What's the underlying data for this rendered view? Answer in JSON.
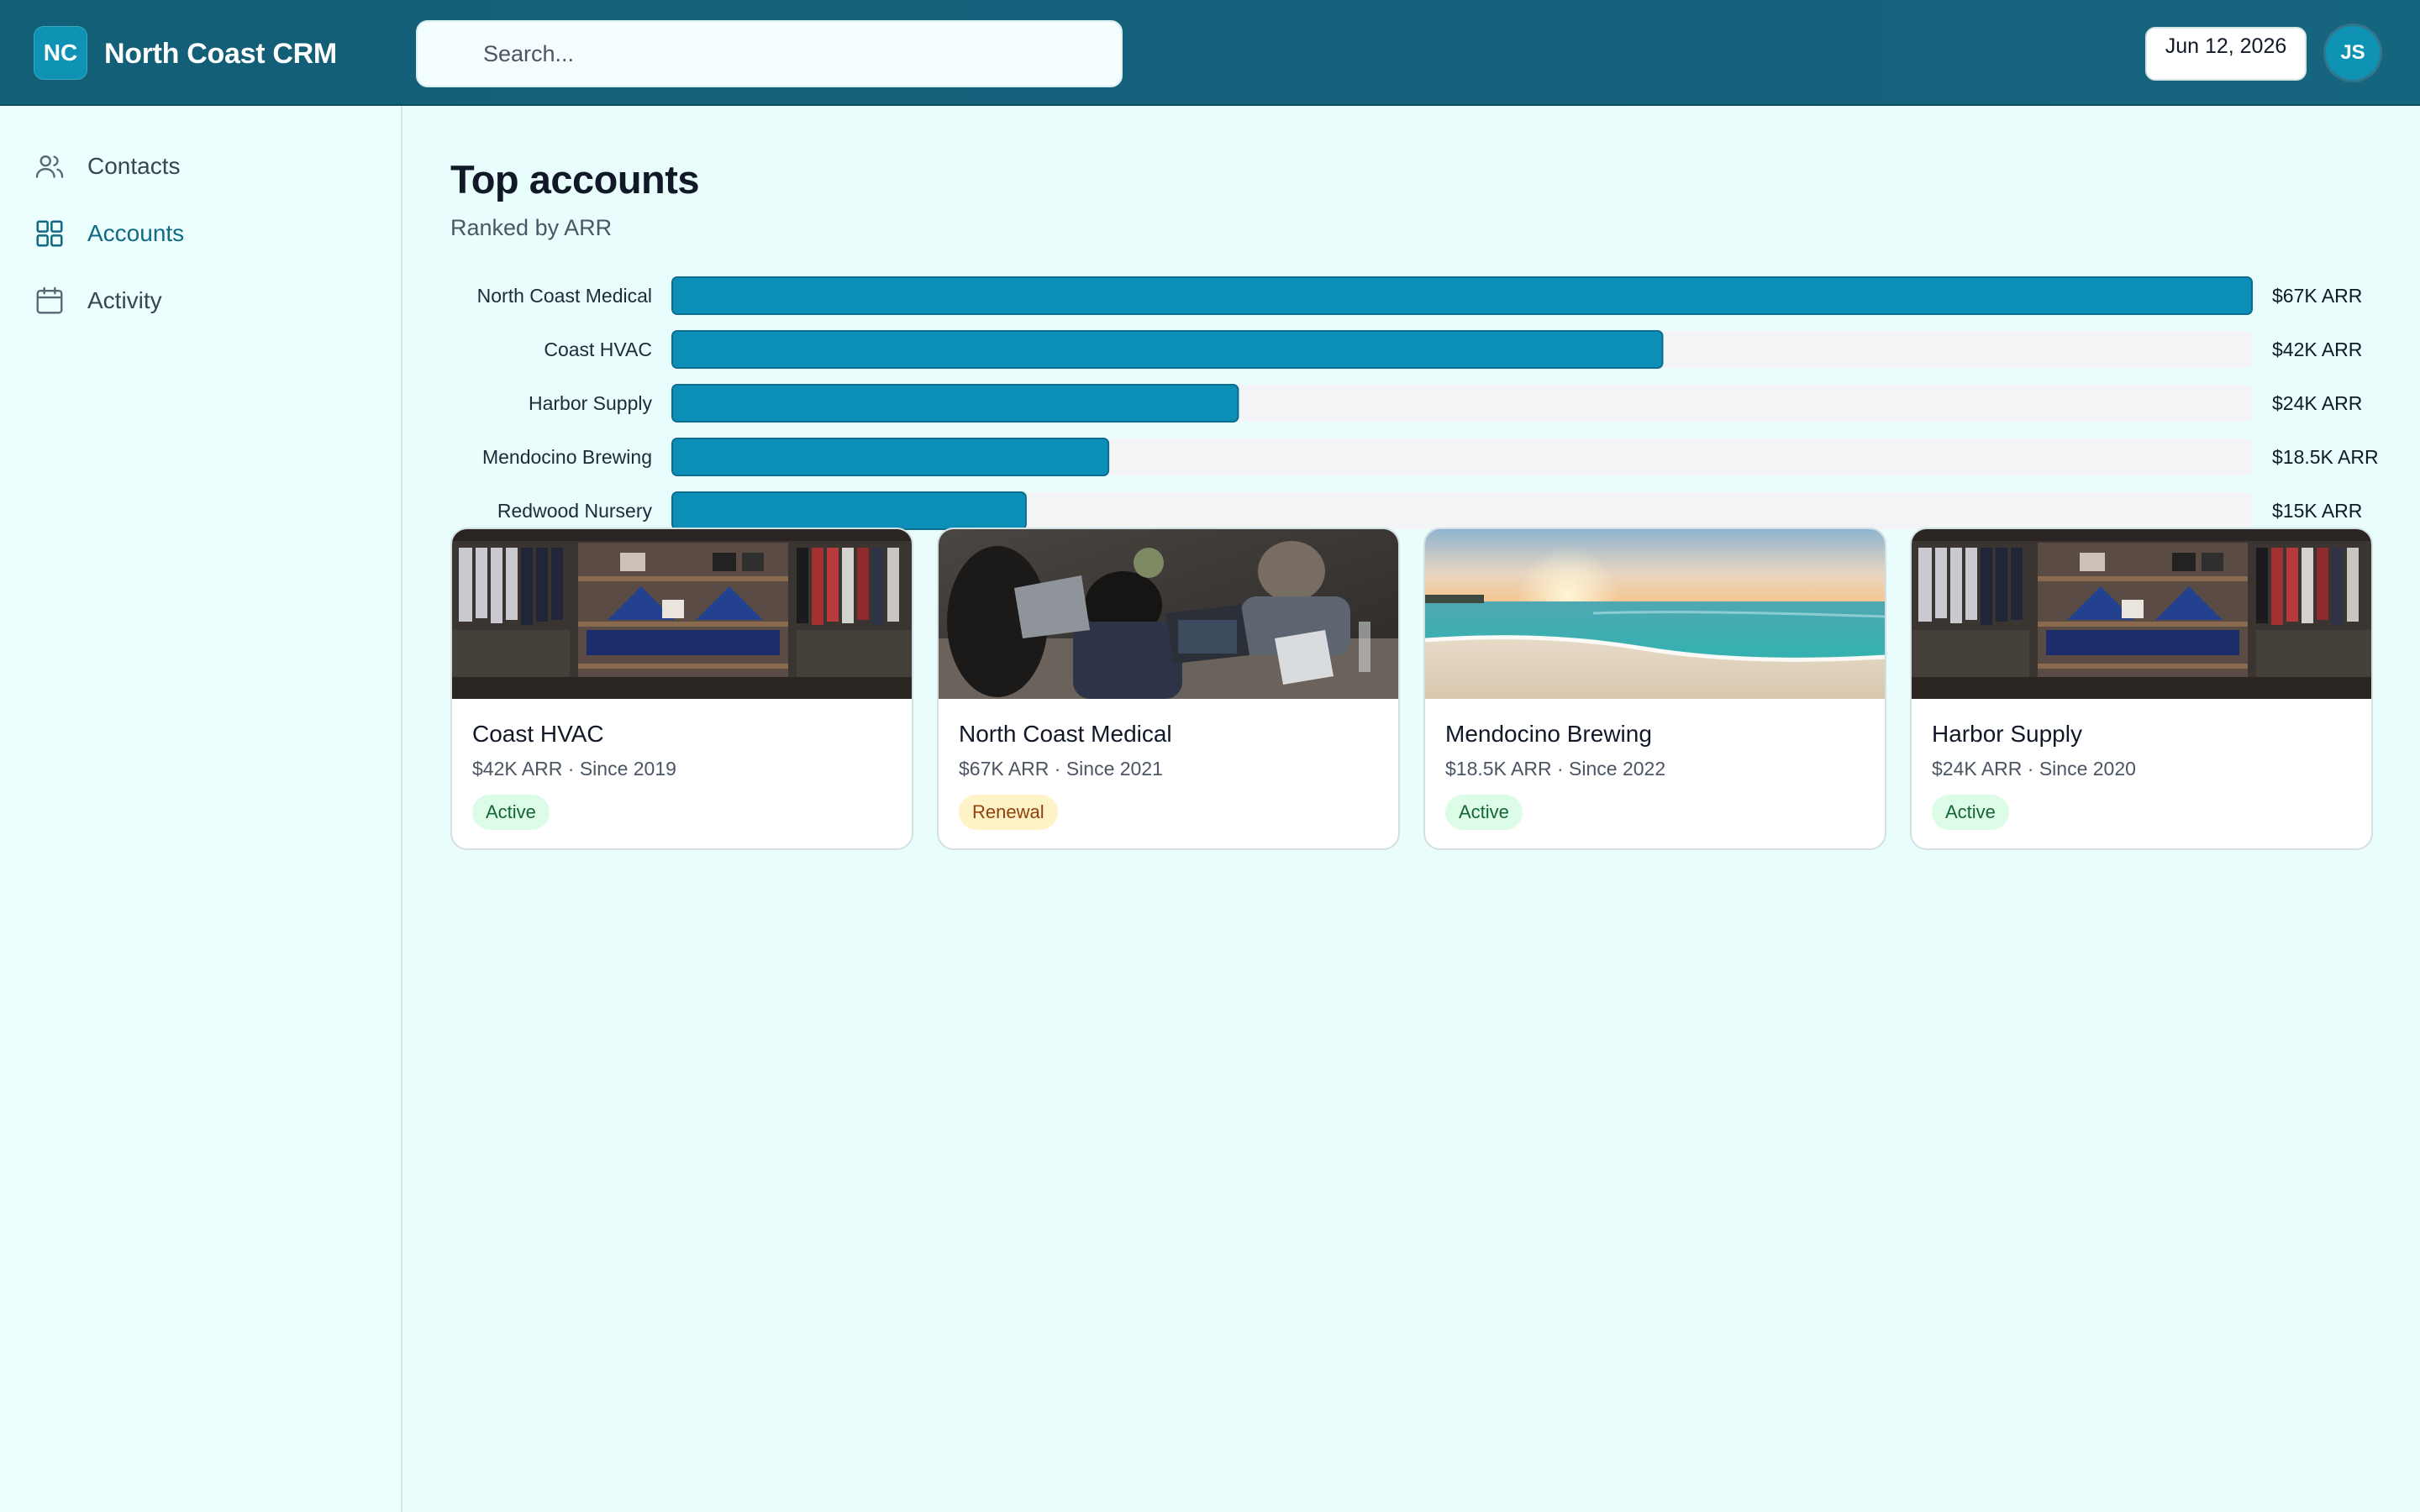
{
  "app": {
    "logo_initials": "NC",
    "name": "North Coast CRM"
  },
  "search": {
    "placeholder": "Search...",
    "value": ""
  },
  "header": {
    "date": "Jun 12, 2026",
    "user_initials": "JS"
  },
  "sidebar": {
    "items": [
      {
        "label": "Contacts",
        "icon": "users-icon",
        "active": false
      },
      {
        "label": "Accounts",
        "icon": "grid-icon",
        "active": true
      },
      {
        "label": "Activity",
        "icon": "calendar-icon",
        "active": false
      }
    ]
  },
  "main": {
    "title": "Top accounts",
    "subtitle": "Ranked by ARR"
  },
  "chart_data": {
    "type": "bar",
    "orientation": "horizontal",
    "categories": [
      "North Coast Medical",
      "Coast HVAC",
      "Harbor Supply",
      "Mendocino Brewing",
      "Redwood Nursery"
    ],
    "values": [
      67,
      42,
      24,
      18.5,
      15
    ],
    "value_labels": [
      "$67K ARR",
      "$42K ARR",
      "$24K ARR",
      "$18.5K ARR",
      "$15K ARR"
    ],
    "unit": "K ARR",
    "xlim": [
      0,
      67
    ],
    "grid": false,
    "legend": "none",
    "bar_color": "#0b8fb6",
    "track_color": "#f3f4f5"
  },
  "cards": [
    {
      "title": "Coast HVAC",
      "meta": "$42K ARR · Since 2019",
      "status": "Active",
      "status_kind": "active",
      "image": "retail-shop-photo"
    },
    {
      "title": "North Coast Medical",
      "meta": "$67K ARR · Since 2021",
      "status": "Renewal",
      "status_kind": "renewal",
      "image": "team-laptops-photo"
    },
    {
      "title": "Mendocino Brewing",
      "meta": "$18.5K ARR · Since 2022",
      "status": "Active",
      "status_kind": "active",
      "image": "beach-sunset-photo"
    },
    {
      "title": "Harbor Supply",
      "meta": "$24K ARR · Since 2020",
      "status": "Active",
      "status_kind": "active",
      "image": "retail-shop-photo"
    }
  ],
  "colors": {
    "header_bg": "#15607a",
    "accent": "#0f93b5",
    "active_nav": "#0f6a86",
    "page_bg": "#e8fdfc",
    "badge_active_bg": "#dcfce7",
    "badge_renewal_bg": "#fef3c7"
  }
}
